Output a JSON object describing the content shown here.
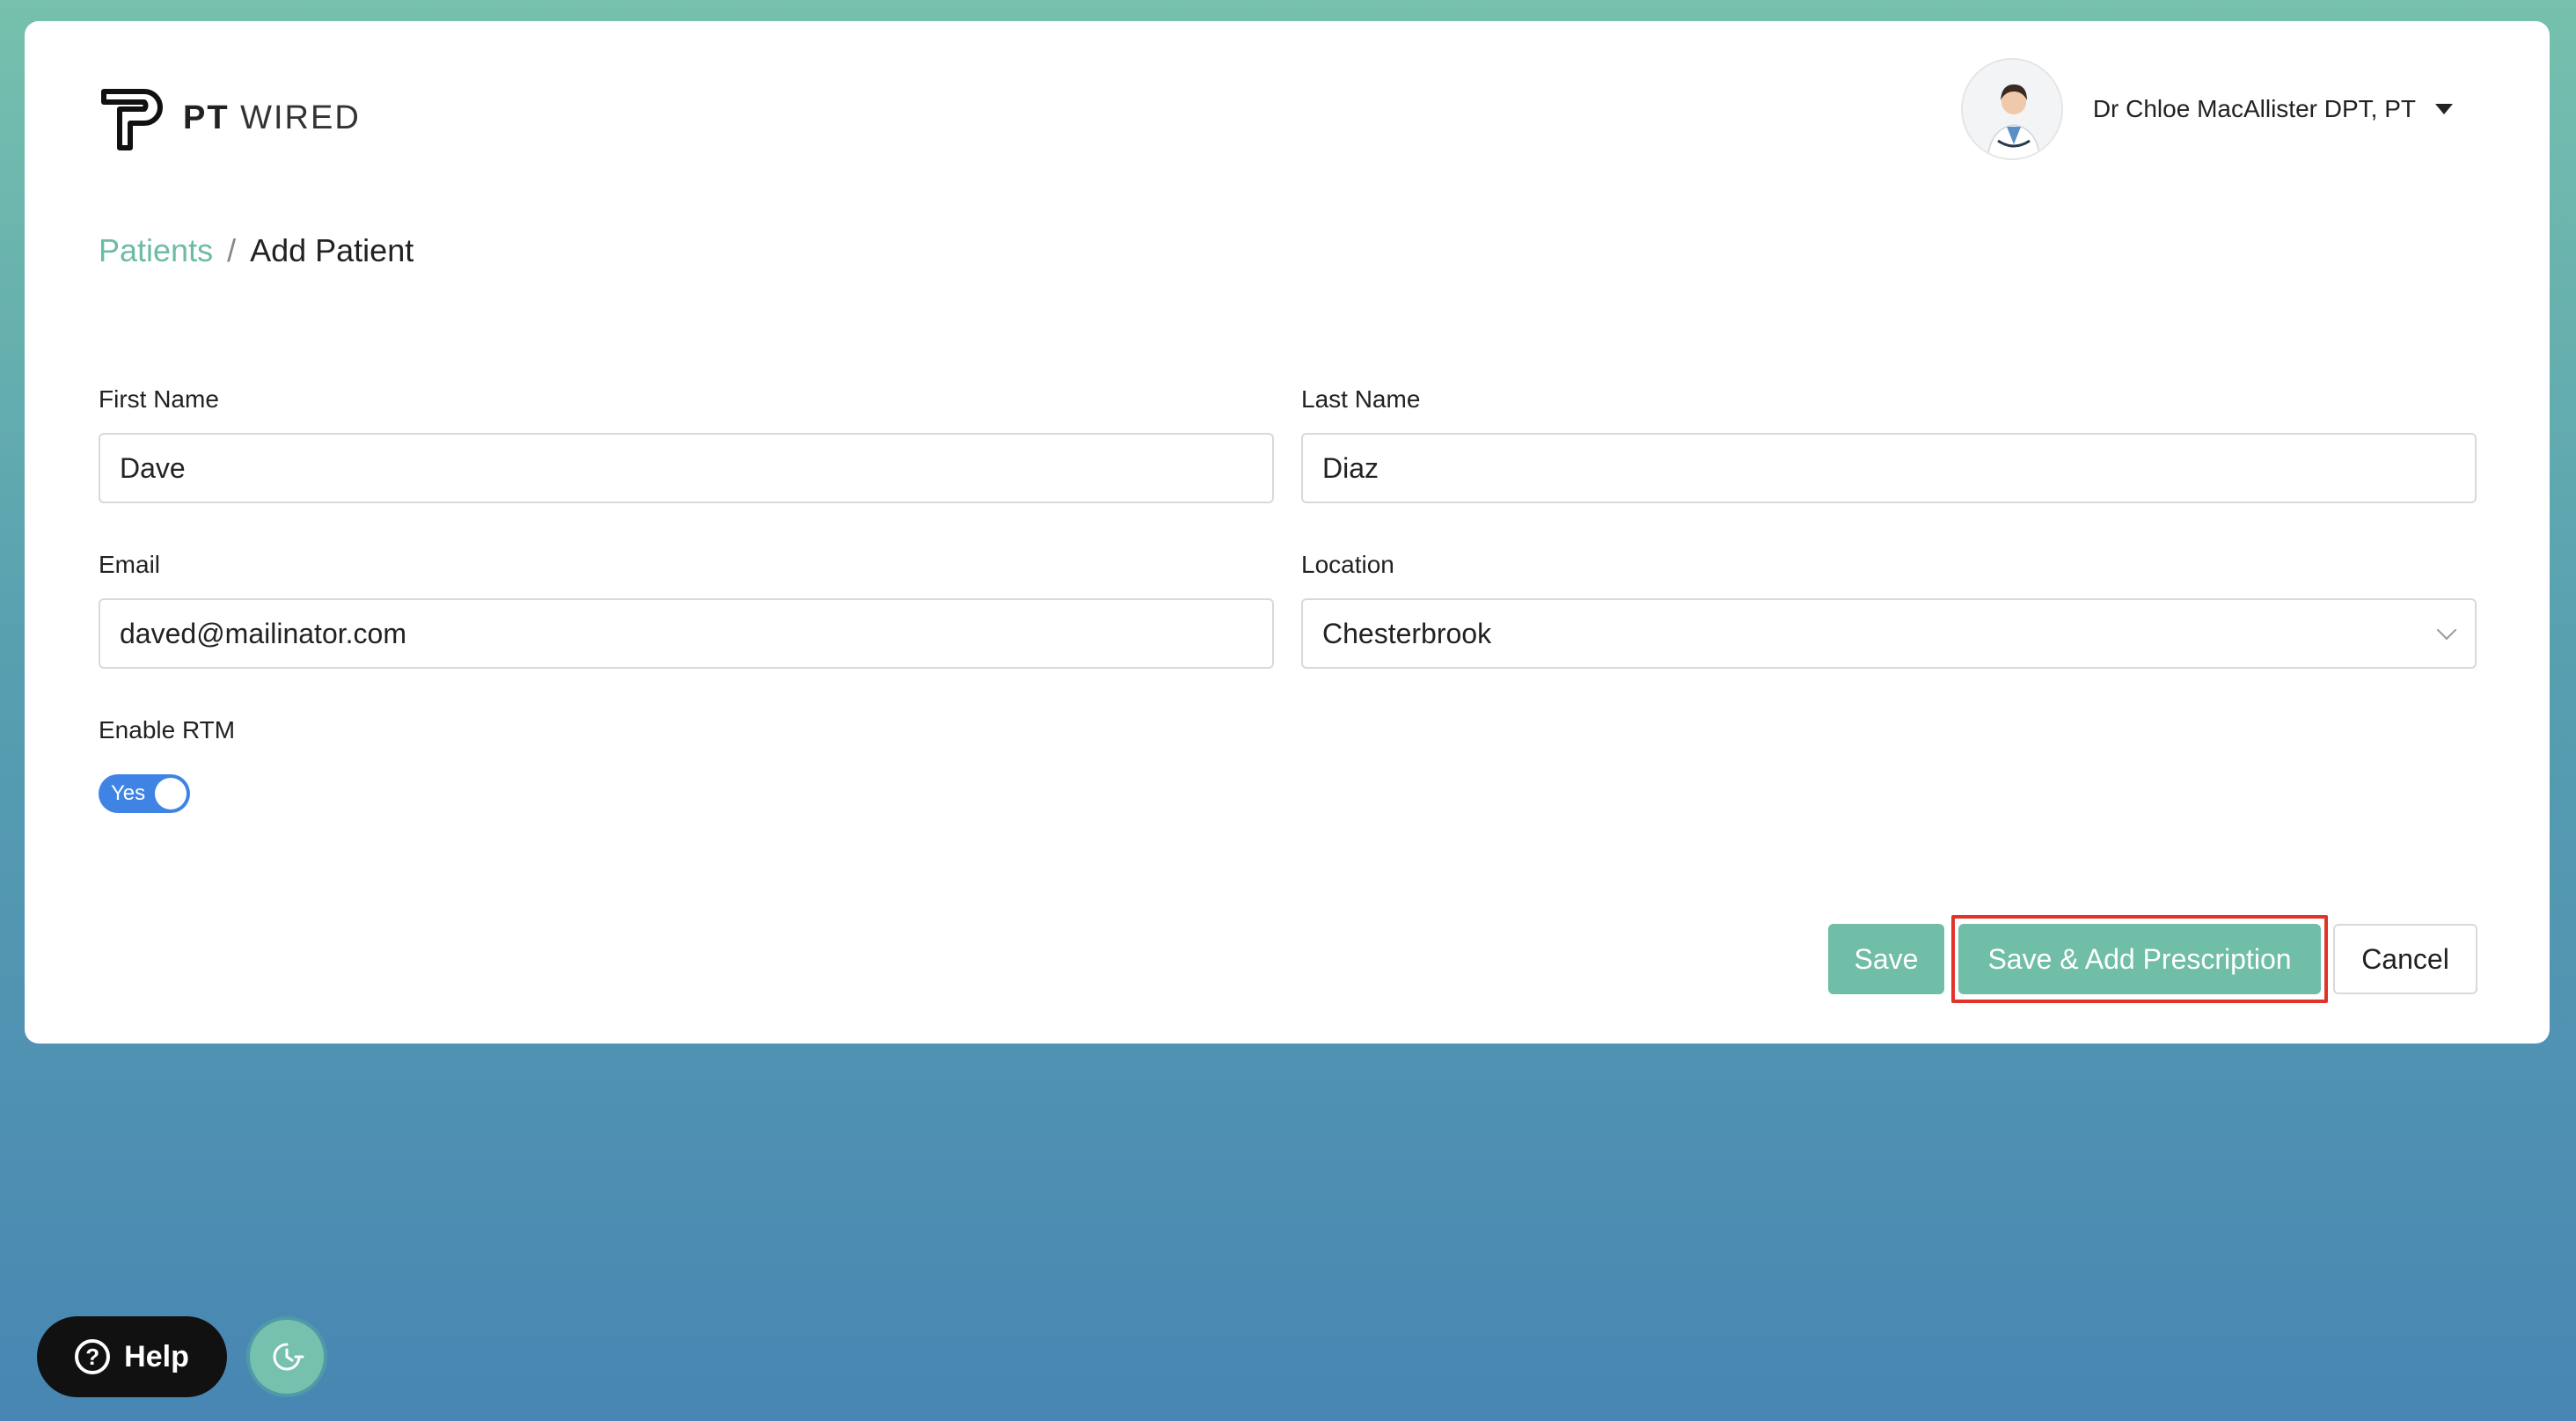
{
  "logo": {
    "brand_bold": "PT",
    "brand_light": "WIRED"
  },
  "user": {
    "name": "Dr Chloe MacAllister DPT, PT"
  },
  "breadcrumb": {
    "parent": "Patients",
    "separator": "/",
    "current": "Add Patient"
  },
  "form": {
    "first_name": {
      "label": "First Name",
      "value": "Dave"
    },
    "last_name": {
      "label": "Last Name",
      "value": "Diaz"
    },
    "email": {
      "label": "Email",
      "value": "daved@mailinator.com"
    },
    "location": {
      "label": "Location",
      "value": "Chesterbrook"
    },
    "rtm": {
      "label": "Enable RTM",
      "toggle_text": "Yes",
      "enabled": true
    }
  },
  "actions": {
    "save": "Save",
    "save_add_prescription": "Save & Add Prescription",
    "cancel": "Cancel"
  },
  "help": {
    "label": "Help"
  },
  "colors": {
    "accent": "#71bea8",
    "toggle_on": "#3f84e5",
    "highlight": "#e2332a"
  }
}
